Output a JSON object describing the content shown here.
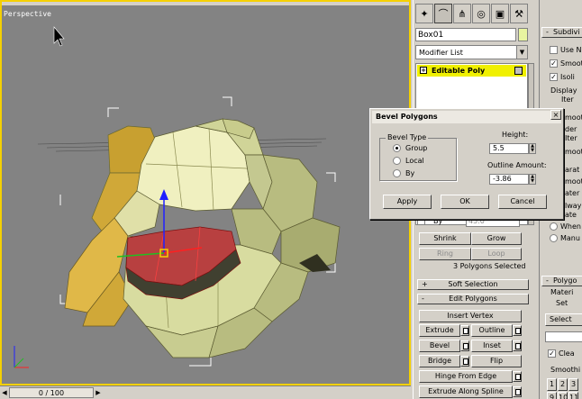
{
  "viewport": {
    "label": "Perspective"
  },
  "timeline": {
    "frame_readout": "0 / 100"
  },
  "command_panel": {
    "object_name": "Box01",
    "object_color": "#e8f4a0",
    "modifier_list_label": "Modifier List",
    "stack_item": "Editable Poly",
    "stack_highlight_color": "#f0f000",
    "by_label": "By",
    "by_value": "45.0",
    "shrink_label": "Shrink",
    "grow_label": "Grow",
    "ring_label": "Ring",
    "loop_label": "Loop",
    "selection_status": "3 Polygons Selected",
    "soft_selection_label": "Soft Selection",
    "soft_selection_sign": "+",
    "edit_polygons_label": "Edit Polygons",
    "edit_polygons_sign": "-",
    "insert_vertex_label": "Insert Vertex",
    "extrude_label": "Extrude",
    "outline_label": "Outline",
    "bevel_label": "Bevel",
    "inset_label": "Inset",
    "bridge_label": "Bridge",
    "flip_label": "Flip",
    "hinge_label": "Hinge From Edge",
    "extrude_spline_label": "Extrude Along Spline"
  },
  "right_panel": {
    "subdiv_title": "Subdivi",
    "use_n": "Use N",
    "smooth": "Smoot",
    "isoline": "Isoli",
    "display": "Display",
    "iter1": "Iter",
    "smooth2": "moot",
    "render": "der",
    "iter2": "Iter",
    "smooth3": "moot",
    "sep1": "arat",
    "smooth4": "moot",
    "mater": "ater",
    "always": "lway",
    "update": "ate",
    "when": "When",
    "manual": "Manu",
    "polygon_title": "Polygo",
    "material": "Materi",
    "set": "Set",
    "select": "Select",
    "clear": "Clea",
    "smoothing": "Smoothi",
    "sg1": "1",
    "sg2": "2",
    "sg3": "3",
    "sg9": "9",
    "sg10": "10",
    "sg11": "11"
  },
  "dialog": {
    "title": "Bevel Polygons",
    "close_glyph": "×",
    "bevel_type_label": "Bevel Type",
    "options": [
      "Group",
      "Local",
      "By"
    ],
    "selected_option": "Group",
    "height_label": "Height:",
    "height_value": "5.5",
    "outline_label": "Outline Amount:",
    "outline_value": "-3.86",
    "apply_label": "Apply",
    "ok_label": "OK",
    "cancel_label": "Cancel"
  },
  "colors": {
    "viewport_bg": "#838383",
    "active_border": "#f5d000",
    "mesh_face": "#d8dca0",
    "mesh_selected": "#b84040",
    "gizmo_y": "#2020ff",
    "gizmo_x": "#ff2020",
    "gizmo_z": "#20c020"
  },
  "icons": [
    "cursor-icon",
    "create-tab-icon",
    "modify-tab-icon",
    "hierarchy-tab-icon",
    "motion-tab-icon",
    "display-tab-icon",
    "utilities-tab-icon"
  ]
}
